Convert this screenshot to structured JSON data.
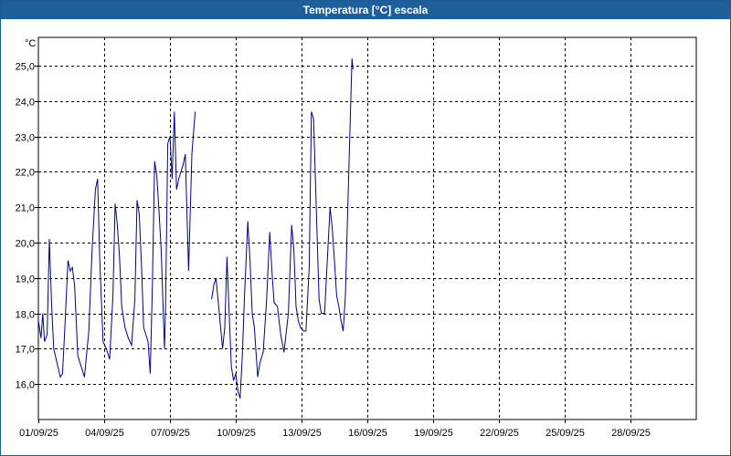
{
  "window": {
    "title": "Temperatura [°C] escala"
  },
  "chart_data": {
    "type": "line",
    "ylabel": "°C",
    "ylim": [
      15.0,
      25.8
    ],
    "yticks": [
      16.0,
      17.0,
      18.0,
      19.0,
      20.0,
      21.0,
      22.0,
      23.0,
      24.0,
      25.0
    ],
    "ytick_labels": [
      "16,0",
      "17,0",
      "18,0",
      "19,0",
      "20,0",
      "21,0",
      "22,0",
      "23,0",
      "24,0",
      "25,0"
    ],
    "xlim": [
      0,
      30
    ],
    "xticks": [
      0,
      3,
      6,
      9,
      12,
      15,
      18,
      21,
      24,
      27
    ],
    "xtick_labels": [
      "01/09/25",
      "04/09/25",
      "07/09/25",
      "10/09/25",
      "13/09/25",
      "16/09/25",
      "19/09/25",
      "22/09/25",
      "25/09/25",
      "28/09/25"
    ],
    "grid": true,
    "line_color": "#00008b",
    "series": [
      {
        "segments": [
          [
            [
              0.0,
              17.8
            ],
            [
              0.12,
              17.3
            ],
            [
              0.2,
              18.0
            ],
            [
              0.28,
              17.2
            ],
            [
              0.4,
              17.4
            ],
            [
              0.5,
              20.1
            ],
            [
              0.6,
              18.3
            ],
            [
              0.7,
              17.0
            ],
            [
              0.85,
              16.6
            ],
            [
              1.0,
              16.2
            ],
            [
              1.1,
              16.3
            ],
            [
              1.2,
              17.5
            ],
            [
              1.35,
              19.5
            ],
            [
              1.45,
              19.2
            ],
            [
              1.55,
              19.3
            ],
            [
              1.65,
              18.8
            ],
            [
              1.8,
              16.8
            ],
            [
              2.0,
              16.4
            ],
            [
              2.1,
              16.2
            ],
            [
              2.3,
              17.5
            ],
            [
              2.45,
              19.8
            ],
            [
              2.6,
              21.5
            ],
            [
              2.7,
              21.8
            ],
            [
              2.8,
              19.5
            ],
            [
              2.95,
              17.2
            ],
            [
              3.1,
              17.0
            ],
            [
              3.25,
              16.7
            ],
            [
              3.4,
              18.5
            ],
            [
              3.5,
              21.1
            ],
            [
              3.6,
              20.5
            ],
            [
              3.7,
              19.6
            ],
            [
              3.8,
              18.2
            ],
            [
              3.95,
              17.6
            ],
            [
              4.1,
              17.3
            ],
            [
              4.25,
              17.1
            ],
            [
              4.4,
              18.4
            ],
            [
              4.5,
              21.2
            ],
            [
              4.6,
              20.8
            ],
            [
              4.7,
              19.4
            ],
            [
              4.8,
              17.6
            ],
            [
              5.0,
              17.2
            ],
            [
              5.1,
              16.3
            ],
            [
              5.2,
              18.8
            ],
            [
              5.3,
              22.3
            ],
            [
              5.4,
              21.9
            ],
            [
              5.5,
              20.9
            ],
            [
              5.6,
              19.8
            ],
            [
              5.75,
              17.0
            ],
            [
              5.8,
              18.2
            ],
            [
              5.9,
              22.8
            ],
            [
              6.0,
              23.0
            ],
            [
              6.1,
              21.8
            ],
            [
              6.2,
              23.7
            ],
            [
              6.3,
              21.5
            ],
            [
              6.4,
              21.8
            ],
            [
              6.5,
              22.0
            ],
            [
              6.6,
              22.2
            ],
            [
              6.7,
              22.5
            ],
            [
              6.85,
              19.2
            ],
            [
              7.0,
              22.5
            ],
            [
              7.15,
              23.7
            ]
          ],
          [
            [
              7.9,
              18.4
            ],
            [
              8.0,
              18.8
            ],
            [
              8.1,
              19.0
            ],
            [
              8.25,
              18.0
            ],
            [
              8.4,
              17.0
            ],
            [
              8.5,
              17.6
            ],
            [
              8.6,
              19.6
            ],
            [
              8.7,
              18.0
            ],
            [
              8.8,
              16.5
            ],
            [
              8.9,
              16.1
            ],
            [
              9.0,
              16.3
            ],
            [
              9.1,
              15.8
            ],
            [
              9.2,
              15.6
            ],
            [
              9.3,
              16.8
            ],
            [
              9.4,
              18.5
            ],
            [
              9.55,
              20.6
            ],
            [
              9.65,
              19.5
            ],
            [
              9.75,
              18.0
            ],
            [
              9.85,
              17.6
            ],
            [
              10.0,
              16.2
            ],
            [
              10.1,
              16.6
            ],
            [
              10.25,
              16.9
            ],
            [
              10.4,
              18.3
            ],
            [
              10.55,
              20.3
            ],
            [
              10.65,
              19.2
            ],
            [
              10.75,
              18.3
            ],
            [
              10.9,
              18.2
            ],
            [
              11.05,
              17.4
            ],
            [
              11.2,
              16.9
            ],
            [
              11.4,
              18.0
            ],
            [
              11.55,
              20.5
            ],
            [
              11.65,
              19.8
            ],
            [
              11.75,
              18.2
            ],
            [
              11.85,
              17.8
            ],
            [
              11.95,
              17.6
            ],
            [
              12.1,
              17.5
            ],
            [
              12.2,
              17.5
            ],
            [
              12.35,
              19.3
            ],
            [
              12.45,
              23.7
            ],
            [
              12.55,
              23.5
            ],
            [
              12.7,
              20.4
            ],
            [
              12.8,
              18.4
            ],
            [
              12.9,
              18.0
            ],
            [
              13.05,
              18.0
            ],
            [
              13.2,
              19.8
            ],
            [
              13.3,
              21.0
            ],
            [
              13.4,
              20.4
            ],
            [
              13.5,
              19.5
            ],
            [
              13.6,
              18.5
            ],
            [
              13.7,
              18.2
            ],
            [
              13.8,
              17.8
            ],
            [
              13.9,
              17.5
            ],
            [
              14.0,
              18.5
            ],
            [
              14.1,
              20.8
            ],
            [
              14.2,
              23.0
            ],
            [
              14.3,
              25.2
            ],
            [
              14.35,
              24.9
            ]
          ]
        ]
      }
    ]
  }
}
